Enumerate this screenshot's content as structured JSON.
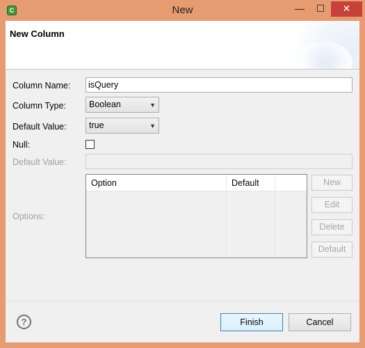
{
  "window": {
    "title": "New",
    "minimize": "—",
    "maximize": "☐",
    "close": "✕",
    "app_icon": "C"
  },
  "banner": {
    "title": "New Column"
  },
  "form": {
    "column_name_label": "Column Name:",
    "column_name_value": "isQuery",
    "column_type_label": "Column Type:",
    "column_type_value": "Boolean",
    "default_value_label": "Default Value:",
    "default_value_value": "true",
    "null_label": "Null:",
    "null_checked": false,
    "default_value2_label": "Default Value:",
    "default_value2_value": "",
    "options_label": "Options:"
  },
  "options_table": {
    "columns": [
      "Option",
      "Default",
      ""
    ],
    "rows": []
  },
  "side_buttons": {
    "new": "New",
    "edit": "Edit",
    "delete": "Delete",
    "default": "Default"
  },
  "footer": {
    "finish": "Finish",
    "cancel": "Cancel",
    "help_icon": "?"
  },
  "colors": {
    "titlebar": "#e69b70",
    "close_button": "#c7413a",
    "primary_button_border": "#3c7fb1"
  }
}
